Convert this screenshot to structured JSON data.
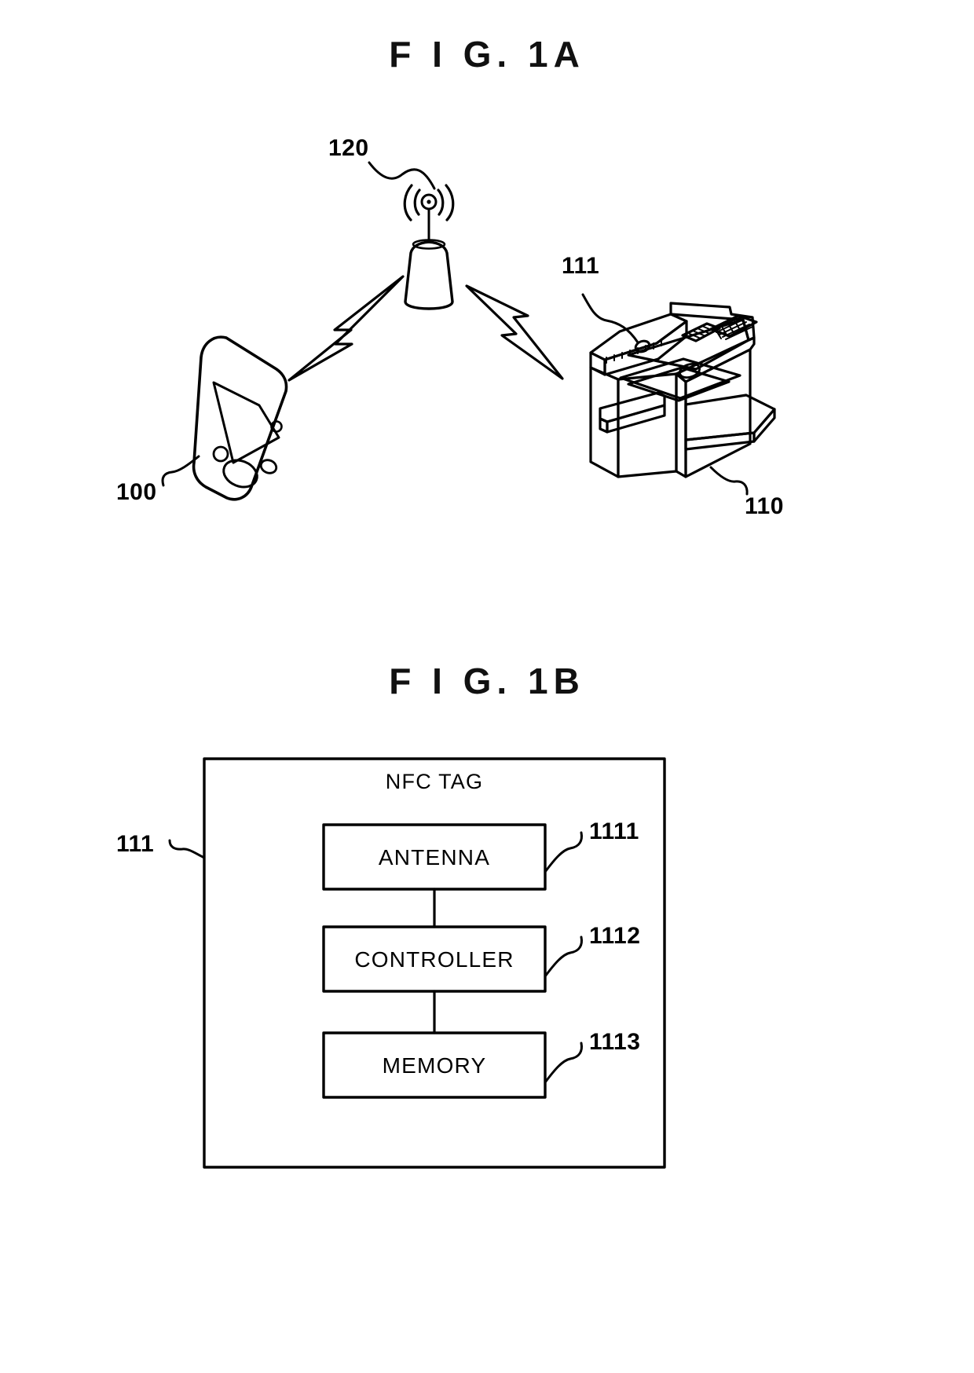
{
  "document": {
    "type": "patent-drawing-sheet",
    "background": "#ffffff",
    "ink": "#000000"
  },
  "figures": [
    {
      "id": "fig-1a",
      "title": "F I G.  1A",
      "caption_text": "F I G.  1A",
      "description": "System overview: mobile terminal communicating through a wireless access point with a printer that carries an NFC tag."
    },
    {
      "id": "fig-1b",
      "title": "F I G.  1B",
      "caption_text": "F I G.  1B",
      "description": "Block diagram of the NFC tag showing antenna, controller and memory."
    }
  ],
  "fig1a": {
    "title": "F I G.  1A",
    "reference_numbers": [
      {
        "id": "ref-100",
        "label": "100",
        "refers_to": "mobile-terminal"
      },
      {
        "id": "ref-120",
        "label": "120",
        "refers_to": "wireless-access-point"
      },
      {
        "id": "ref-111",
        "label": "111",
        "refers_to": "nfc-tag-on-printer"
      },
      {
        "id": "ref-110",
        "label": "110",
        "refers_to": "printer"
      }
    ],
    "elements": {
      "mobile_terminal": "mobile-terminal-illustration",
      "access_point": "wireless-access-point-illustration",
      "printer": "printer-illustration",
      "link_left": "lightning-bolt-wireless-link-left",
      "link_right": "lightning-bolt-wireless-link-right"
    }
  },
  "fig1b": {
    "title": "F I G.  1B",
    "outer_box_label": "NFC TAG",
    "outer_reference": "111",
    "blocks": [
      {
        "id": "block-antenna",
        "label": "ANTENNA",
        "reference": "1111"
      },
      {
        "id": "block-controller",
        "label": "CONTROLLER",
        "reference": "1112"
      },
      {
        "id": "block-memory",
        "label": "MEMORY",
        "reference": "1113"
      }
    ],
    "connections": [
      {
        "from": "ANTENNA",
        "to": "CONTROLLER"
      },
      {
        "from": "CONTROLLER",
        "to": "MEMORY"
      }
    ]
  }
}
